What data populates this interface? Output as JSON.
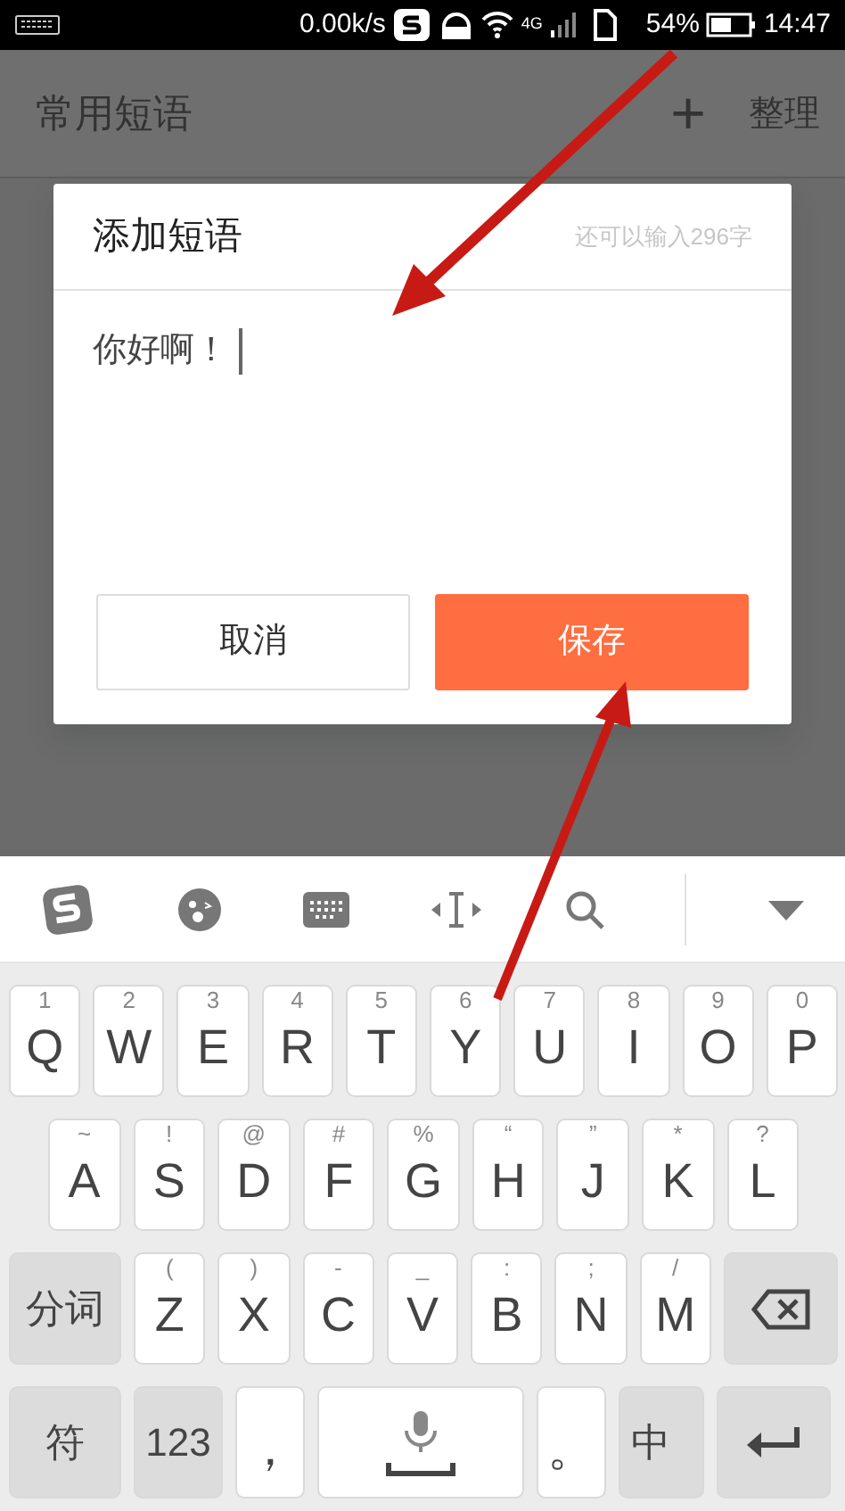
{
  "status_bar": {
    "speed": "0.00k/s",
    "network": "4G",
    "battery": "54%",
    "time": "14:47"
  },
  "header": {
    "title": "常用短语",
    "add": "+",
    "action": "整理"
  },
  "dialog": {
    "title": "添加短语",
    "counter": "还可以输入296字",
    "value": "你好啊！",
    "buttons": [
      {
        "label": "取消",
        "kind": "secondary"
      },
      {
        "label": "保存",
        "kind": "primary"
      }
    ]
  },
  "keyboard": {
    "rows": [
      [
        {
          "label": "Q",
          "hint": "1",
          "kind": "letter"
        },
        {
          "label": "W",
          "hint": "2",
          "kind": "letter"
        },
        {
          "label": "E",
          "hint": "3",
          "kind": "letter"
        },
        {
          "label": "R",
          "hint": "4",
          "kind": "letter"
        },
        {
          "label": "T",
          "hint": "5",
          "kind": "letter"
        },
        {
          "label": "Y",
          "hint": "6",
          "kind": "letter"
        },
        {
          "label": "U",
          "hint": "7",
          "kind": "letter"
        },
        {
          "label": "I",
          "hint": "8",
          "kind": "letter"
        },
        {
          "label": "O",
          "hint": "9",
          "kind": "letter"
        },
        {
          "label": "P",
          "hint": "0",
          "kind": "letter"
        }
      ],
      [
        {
          "label": "A",
          "hint": "~",
          "kind": "letter"
        },
        {
          "label": "S",
          "hint": "!",
          "kind": "letter"
        },
        {
          "label": "D",
          "hint": "@",
          "kind": "letter"
        },
        {
          "label": "F",
          "hint": "#",
          "kind": "letter"
        },
        {
          "label": "G",
          "hint": "%",
          "kind": "letter"
        },
        {
          "label": "H",
          "hint": "“",
          "kind": "letter"
        },
        {
          "label": "J",
          "hint": "”",
          "kind": "letter"
        },
        {
          "label": "K",
          "hint": "*",
          "kind": "letter"
        },
        {
          "label": "L",
          "hint": "?",
          "kind": "letter"
        }
      ],
      [
        {
          "label": "分词",
          "kind": "function"
        },
        {
          "label": "Z",
          "hint": "(",
          "kind": "letter"
        },
        {
          "label": "X",
          "hint": ")",
          "kind": "letter"
        },
        {
          "label": "C",
          "hint": "-",
          "kind": "letter"
        },
        {
          "label": "V",
          "hint": "_",
          "kind": "letter"
        },
        {
          "label": "B",
          "hint": ":",
          "kind": "letter"
        },
        {
          "label": "N",
          "hint": ";",
          "kind": "letter"
        },
        {
          "label": "M",
          "hint": "/",
          "kind": "letter"
        },
        {
          "kind": "delete"
        }
      ],
      [
        {
          "label": "符",
          "kind": "function"
        },
        {
          "label": "123",
          "kind": "mode"
        },
        {
          "label": "，",
          "kind": "punct"
        },
        {
          "kind": "space"
        },
        {
          "label": "。",
          "kind": "punct"
        },
        {
          "label": "中",
          "kind": "lang"
        },
        {
          "kind": "enter"
        }
      ]
    ]
  }
}
